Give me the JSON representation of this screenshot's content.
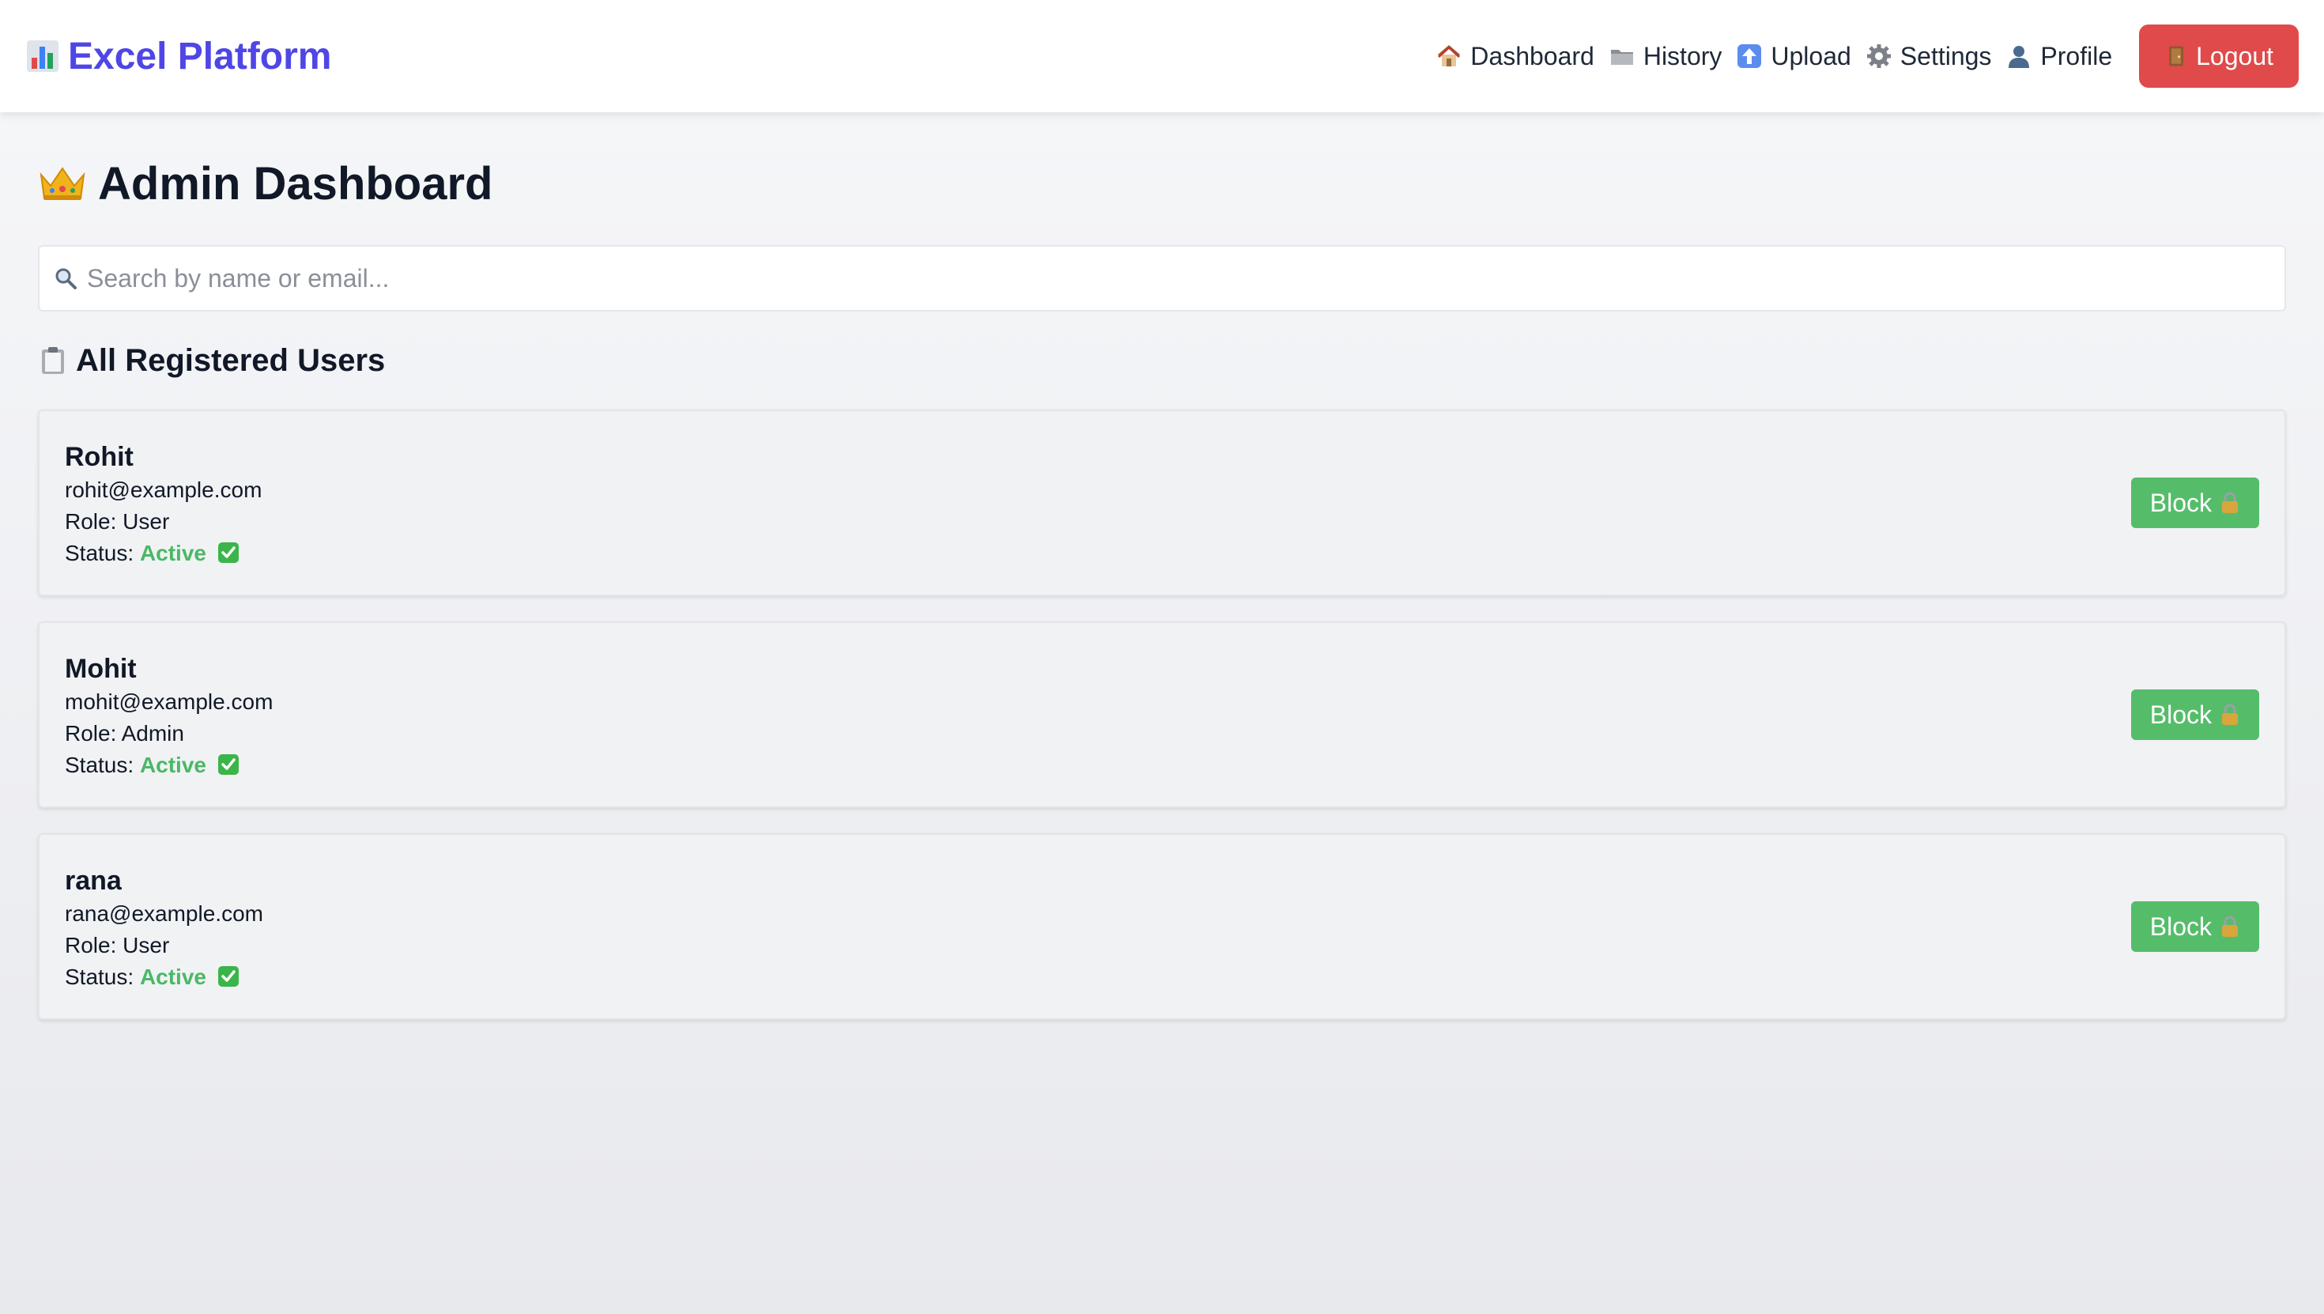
{
  "navbar": {
    "brand": "Excel Platform",
    "brand_icon": "bar-chart-icon",
    "links": [
      {
        "label": "Dashboard",
        "icon": "house-icon"
      },
      {
        "label": "History",
        "icon": "folder-icon"
      },
      {
        "label": "Upload",
        "icon": "upload-arrow-icon"
      },
      {
        "label": "Settings",
        "icon": "gear-icon"
      },
      {
        "label": "Profile",
        "icon": "user-silhouette-icon"
      }
    ],
    "logout_label": "Logout",
    "logout_icon": "door-icon"
  },
  "page": {
    "title": "Admin Dashboard",
    "title_icon": "crown-icon"
  },
  "search": {
    "placeholder": "Search by name or email...",
    "value": ""
  },
  "section": {
    "title": "All Registered Users",
    "icon": "clipboard-icon"
  },
  "users": [
    {
      "name": "Rohit",
      "email": "rohit@example.com",
      "role_label": "Role: User",
      "status_label": "Status: ",
      "status": "Active",
      "action_label": "Block"
    },
    {
      "name": "Mohit",
      "email": "mohit@example.com",
      "role_label": "Role: Admin",
      "status_label": "Status: ",
      "status": "Active",
      "action_label": "Block"
    },
    {
      "name": "rana",
      "email": "rana@example.com",
      "role_label": "Role: User",
      "status_label": "Status: ",
      "status": "Active",
      "action_label": "Block"
    }
  ],
  "colors": {
    "brand": "#4f46e5",
    "logout": "#e04a4a",
    "block_button": "#55bd6a",
    "status_active": "#4ab866"
  }
}
